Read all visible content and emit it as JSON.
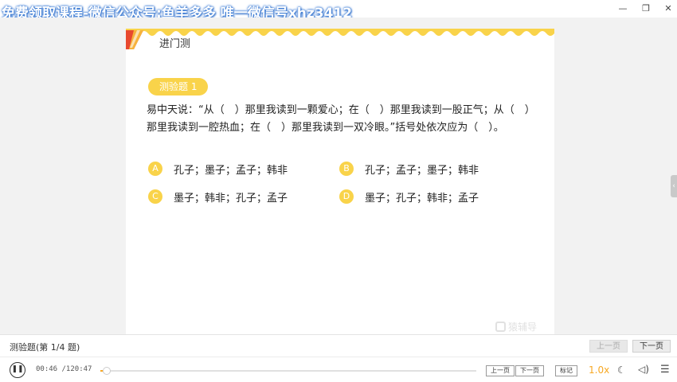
{
  "window": {
    "watermark": "免费领取课程-微信公众号:鱼羊多多 唯一微信号xhz3412",
    "minimize_icon": "minimize-icon",
    "maximize_icon": "maximize-icon",
    "close_icon": "close-icon"
  },
  "card": {
    "title": "进门测",
    "badge": "测验题 1",
    "question": "易中天说：“从（　）那里我读到一颗爱心；在（　）那里我读到一股正气；从（　）那里我读到一腔热血；在（　）那里我读到一双冷眼。”括号处依次应为（　）。",
    "options": [
      {
        "letter": "A",
        "text": "孔子；墨子；孟子；韩非"
      },
      {
        "letter": "B",
        "text": "孔子；孟子；墨子；韩非"
      },
      {
        "letter": "C",
        "text": "墨子；韩非；孔子；孟子"
      },
      {
        "letter": "D",
        "text": "墨子；孔子；韩非；孟子"
      }
    ],
    "logo": "猿辅导",
    "colors": {
      "accent": "#f9d34a",
      "ribbon_red": "#e8492f"
    }
  },
  "question_bar": {
    "label": "测验题(第 1/4 题)",
    "prev": "上一页",
    "next": "下一页"
  },
  "player": {
    "current_time": "00:46",
    "total_time": "/120:47",
    "progress": 0.0064,
    "prev_page": "上一页",
    "next_page": "下一页",
    "mark": "标记",
    "speed": "1.0x",
    "play_icon": "pause-icon",
    "colors": {
      "progress": "#f7a823"
    }
  }
}
